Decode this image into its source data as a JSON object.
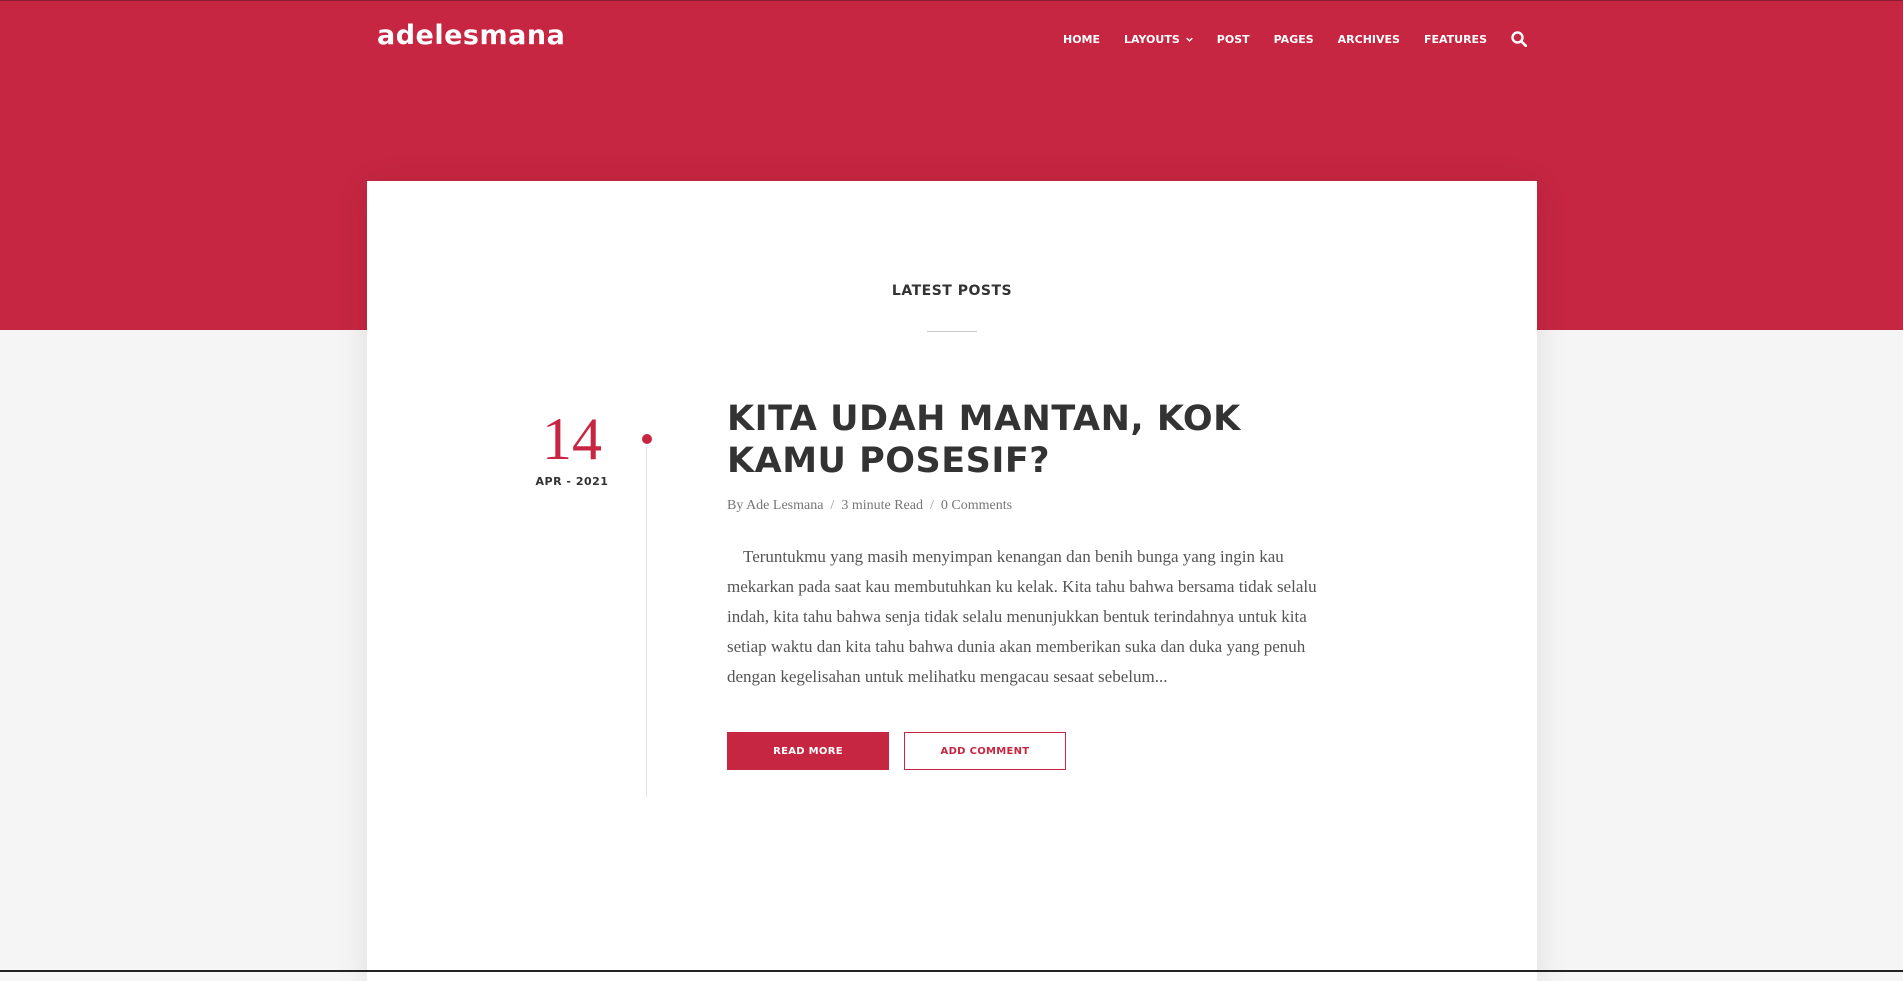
{
  "colors": {
    "accent": "#c62641",
    "text_dark": "#333333",
    "text_muted": "#777777",
    "background": "#f5f5f5"
  },
  "header": {
    "logo": "adelesmana",
    "nav": [
      {
        "label": "HOME"
      },
      {
        "label": "LAYOUTS",
        "has_dropdown": true
      },
      {
        "label": "POST"
      },
      {
        "label": "PAGES"
      },
      {
        "label": "ARCHIVES"
      },
      {
        "label": "FEATURES"
      }
    ],
    "search_icon": "search-icon"
  },
  "main": {
    "section_title": "LATEST POSTS",
    "post": {
      "day": "14",
      "month_year": "APR - 2021",
      "title": "KITA UDAH MANTAN, KOK KAMU POSESIF?",
      "author": "By Ade Lesmana",
      "read_time": "3 minute Read",
      "comments": "0 Comments",
      "excerpt": "Teruntukmu yang masih menyimpan kenangan dan benih bunga yang ingin kau mekarkan pada saat kau membutuhkan ku kelak. Kita tahu bahwa bersama tidak selalu indah, kita tahu bahwa senja tidak selalu menunjukkan bentuk terindahnya untuk kita setiap waktu dan kita tahu bahwa dunia akan memberikan suka dan duka yang penuh dengan kegelisahan untuk melihatku mengacau sesaat sebelum...",
      "read_more_label": "READ MORE",
      "add_comment_label": "ADD COMMENT"
    }
  }
}
